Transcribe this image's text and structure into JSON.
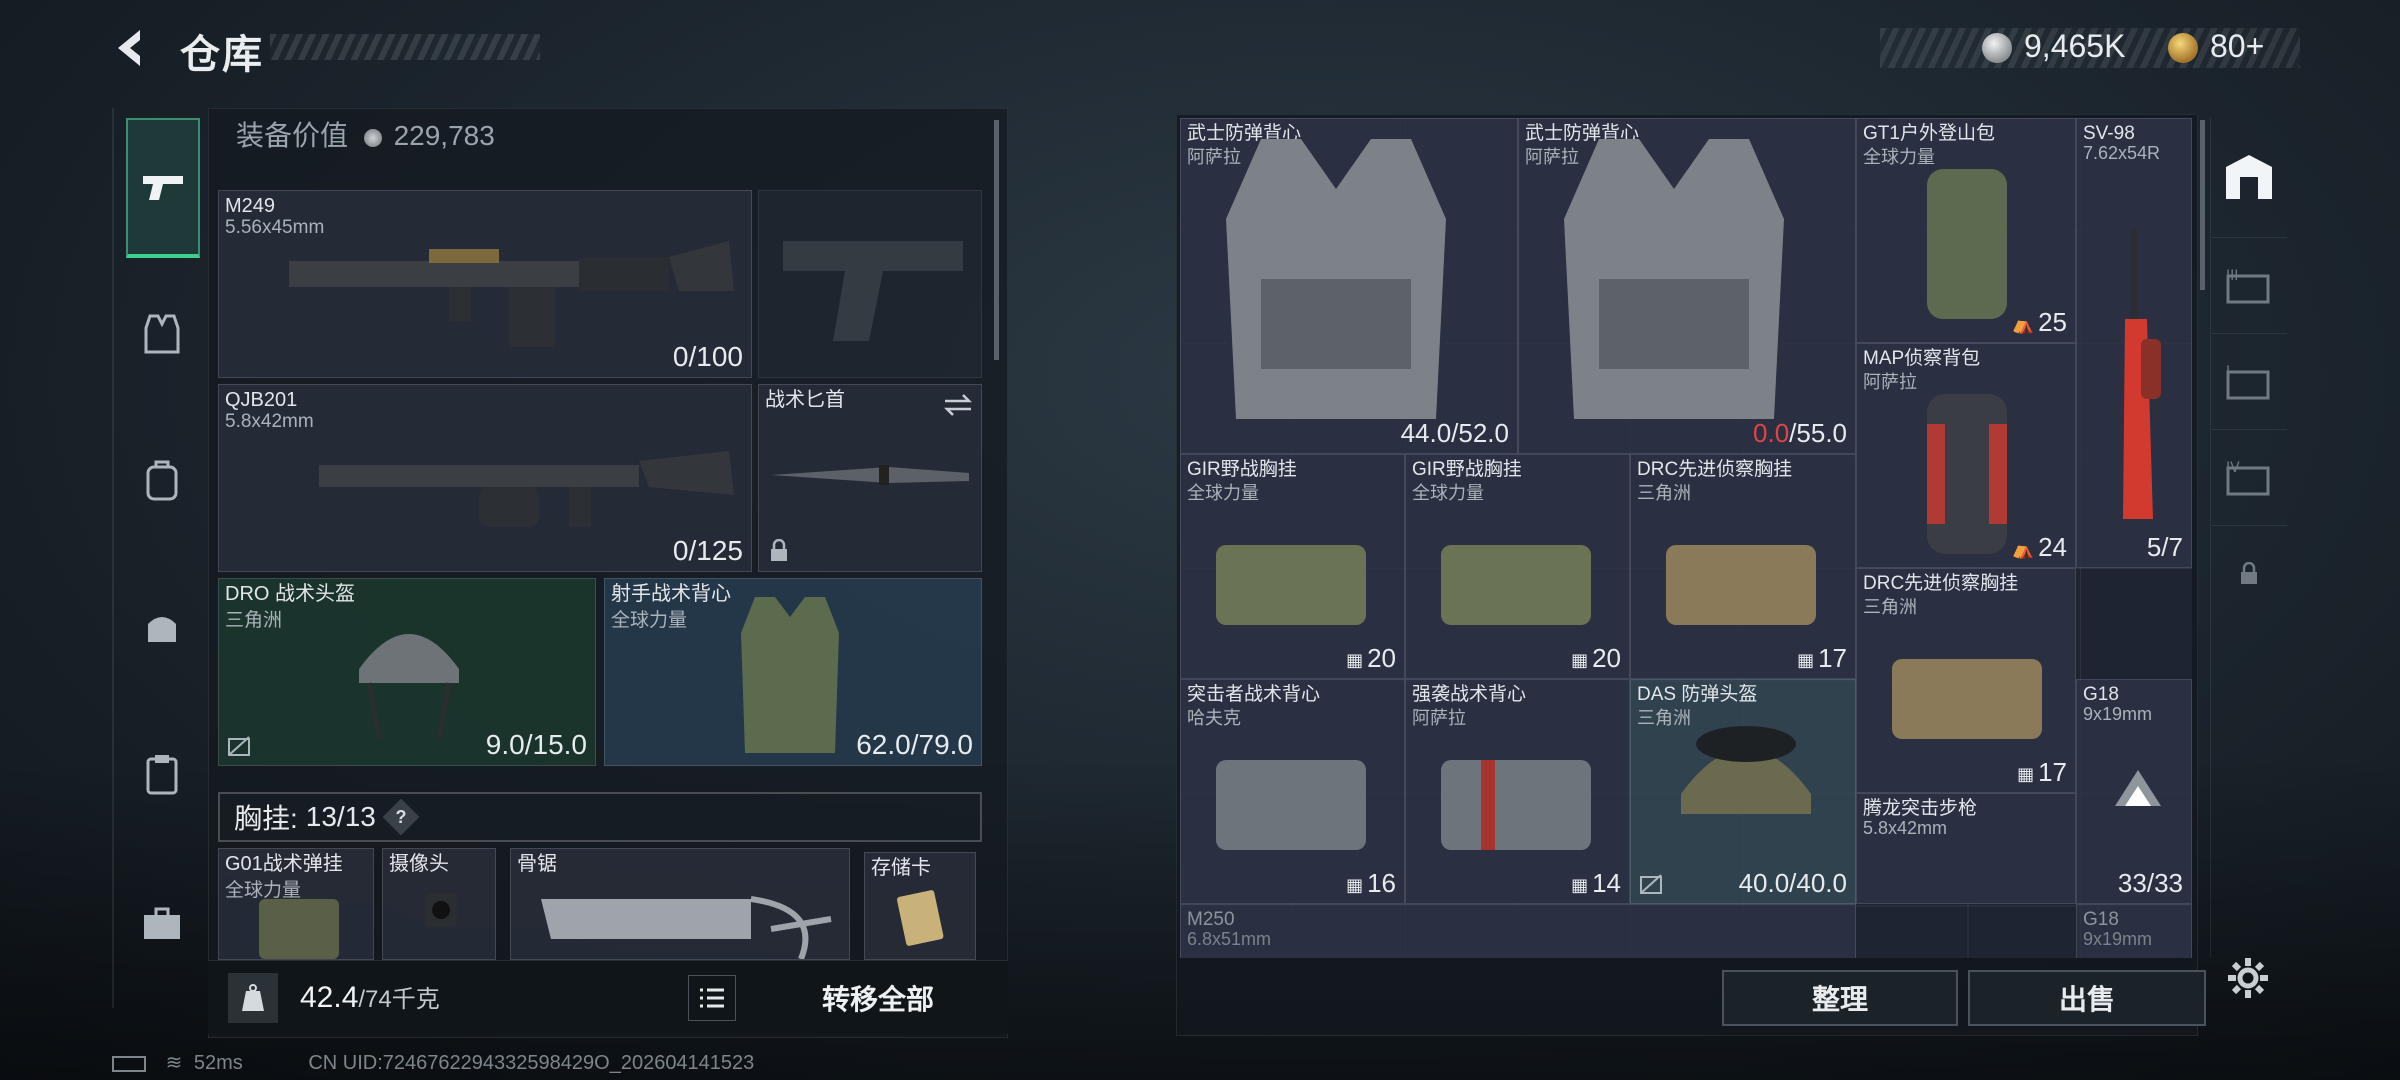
{
  "header": {
    "title": "仓库",
    "coins": "9,465K",
    "tickets": "80+"
  },
  "loadout": {
    "equip_value_label": "装备价值",
    "equip_value": "229,783",
    "primary1": {
      "name": "M249",
      "ammo": "5.56x45mm",
      "count": "0/100"
    },
    "primary2": {
      "name": "QJB201",
      "ammo": "5.8x42mm",
      "count": "0/125"
    },
    "melee": {
      "name": "战术匕首"
    },
    "helmet": {
      "name": "DRO 战术头盔",
      "faction": "三角洲",
      "durability": "9.0/15.0"
    },
    "armor": {
      "name": "射手战术背心",
      "faction": "全球力量",
      "durability": "62.0/79.0"
    },
    "chest_rig": {
      "label": "胸挂:",
      "count": "13/13",
      "help": "?"
    },
    "rig_items": [
      {
        "name": "G01战术弹挂",
        "sub": "全球力量"
      },
      {
        "name": "摄像头",
        "sub": ""
      },
      {
        "name": "骨锯",
        "sub": ""
      },
      {
        "name": "存储卡",
        "sub": ""
      }
    ],
    "weight_current": "42.4",
    "weight_max": "/74千克",
    "transfer_all": "转移全部"
  },
  "stash": {
    "items": [
      {
        "name": "武士防弹背心",
        "sub": "阿萨拉",
        "count": "44.0/52.0"
      },
      {
        "name": "武士防弹背心",
        "sub": "阿萨拉",
        "count_warn": "0.0",
        "count_rest": "/55.0"
      },
      {
        "name": "GT1户外登山包",
        "sub": "全球力量",
        "count": "25"
      },
      {
        "name": "SV-98",
        "sub": "7.62x54R",
        "count": "5/7"
      },
      {
        "name": "MAP侦察背包",
        "sub": "阿萨拉",
        "count": "24"
      },
      {
        "name": "GIR野战胸挂",
        "sub": "全球力量",
        "count": "20"
      },
      {
        "name": "GIR野战胸挂",
        "sub": "全球力量",
        "count": "20"
      },
      {
        "name": "DRC先进侦察胸挂",
        "sub": "三角洲",
        "count": "17"
      },
      {
        "name": "DRC先进侦察胸挂",
        "sub": "三角洲",
        "count": "17"
      },
      {
        "name": "突击者战术背心",
        "sub": "哈夫克",
        "count": "16"
      },
      {
        "name": "强袭战术背心",
        "sub": "阿萨拉",
        "count": "14"
      },
      {
        "name": "DAS 防弹头盔",
        "sub": "三角洲",
        "count": "40.0/40.0"
      },
      {
        "name": "G18",
        "sub": "9x19mm",
        "count": "33/33"
      },
      {
        "name": "腾龙突击步枪",
        "sub": "5.8x42mm",
        "count": ""
      },
      {
        "name": "M250",
        "sub": "6.8x51mm",
        "count": ""
      },
      {
        "name": "G18",
        "sub": "9x19mm",
        "count": ""
      }
    ],
    "sort_button": "整理",
    "sell_button": "出售"
  },
  "status": {
    "ping": "52ms",
    "uid": "CN UID:7246762294332598429O_202604141523"
  },
  "colors": {
    "accent": "#3fcf91",
    "warning": "#e04444"
  }
}
